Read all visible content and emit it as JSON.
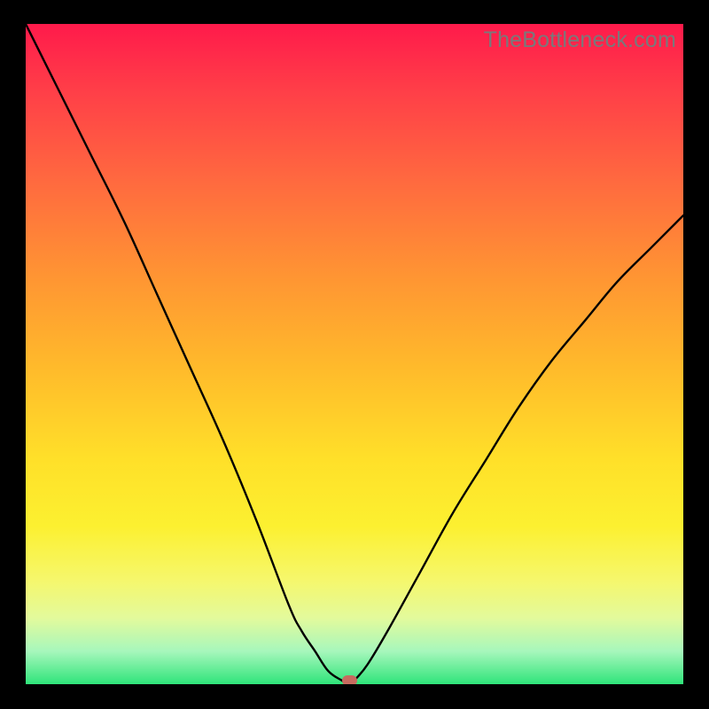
{
  "watermark": "TheBottleneck.com",
  "chart_data": {
    "type": "line",
    "title": "",
    "xlabel": "",
    "ylabel": "",
    "xlim": [
      0,
      100
    ],
    "ylim": [
      0,
      100
    ],
    "x": [
      0,
      5,
      10,
      15,
      20,
      25,
      30,
      35,
      40,
      42,
      44,
      46,
      48,
      49.2,
      50,
      52,
      55,
      60,
      65,
      70,
      75,
      80,
      85,
      90,
      95,
      100
    ],
    "values": [
      100,
      90,
      80,
      70,
      59,
      48,
      37,
      25,
      12,
      8,
      5,
      2,
      0.6,
      0,
      0.6,
      3,
      8,
      17,
      26,
      34,
      42,
      49,
      55,
      61,
      66,
      71
    ],
    "marker": {
      "x": 49.2,
      "y": 0,
      "color": "#c76b5f"
    }
  }
}
